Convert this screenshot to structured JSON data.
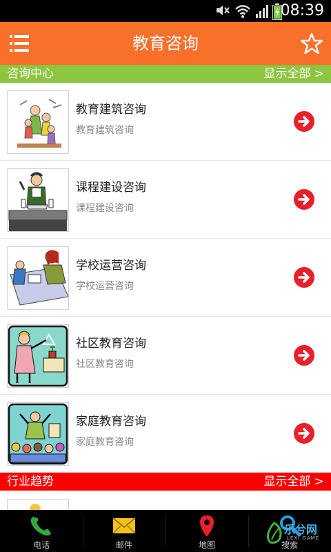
{
  "status": {
    "time": "08:39"
  },
  "app": {
    "title": "教育咨询"
  },
  "sections": {
    "consult": {
      "label": "咨询中心",
      "more": "显示全部 >"
    },
    "trends": {
      "label": "行业趋势",
      "more": "显示全部 >"
    }
  },
  "items": [
    {
      "title": "教育建筑咨询",
      "subtitle": "教育建筑咨询",
      "image": "family-illustration"
    },
    {
      "title": "课程建设咨询",
      "subtitle": "课程建设咨询",
      "image": "teacher-lab-illustration"
    },
    {
      "title": "学校运营咨询",
      "subtitle": "学校运营咨询",
      "image": "student-desk-illustration"
    },
    {
      "title": "社区教育咨询",
      "subtitle": "社区教育咨询",
      "image": "teacher-board-illustration"
    },
    {
      "title": "家庭教育咨询",
      "subtitle": "家庭教育咨询",
      "image": "classroom-illustration"
    }
  ],
  "tabs": [
    {
      "label": "电话",
      "icon": "phone-icon"
    },
    {
      "label": "邮件",
      "icon": "mail-icon"
    },
    {
      "label": "地图",
      "icon": "map-pin-icon"
    },
    {
      "label": "搜索",
      "icon": "search-icon"
    }
  ],
  "watermark": {
    "text": "乐兮网",
    "sub": "LEXI GAME"
  },
  "colors": {
    "appbar": "#f8702a",
    "section_green": "#8cc63e",
    "section_red": "#ff0000",
    "arrow": "#e8202a"
  }
}
